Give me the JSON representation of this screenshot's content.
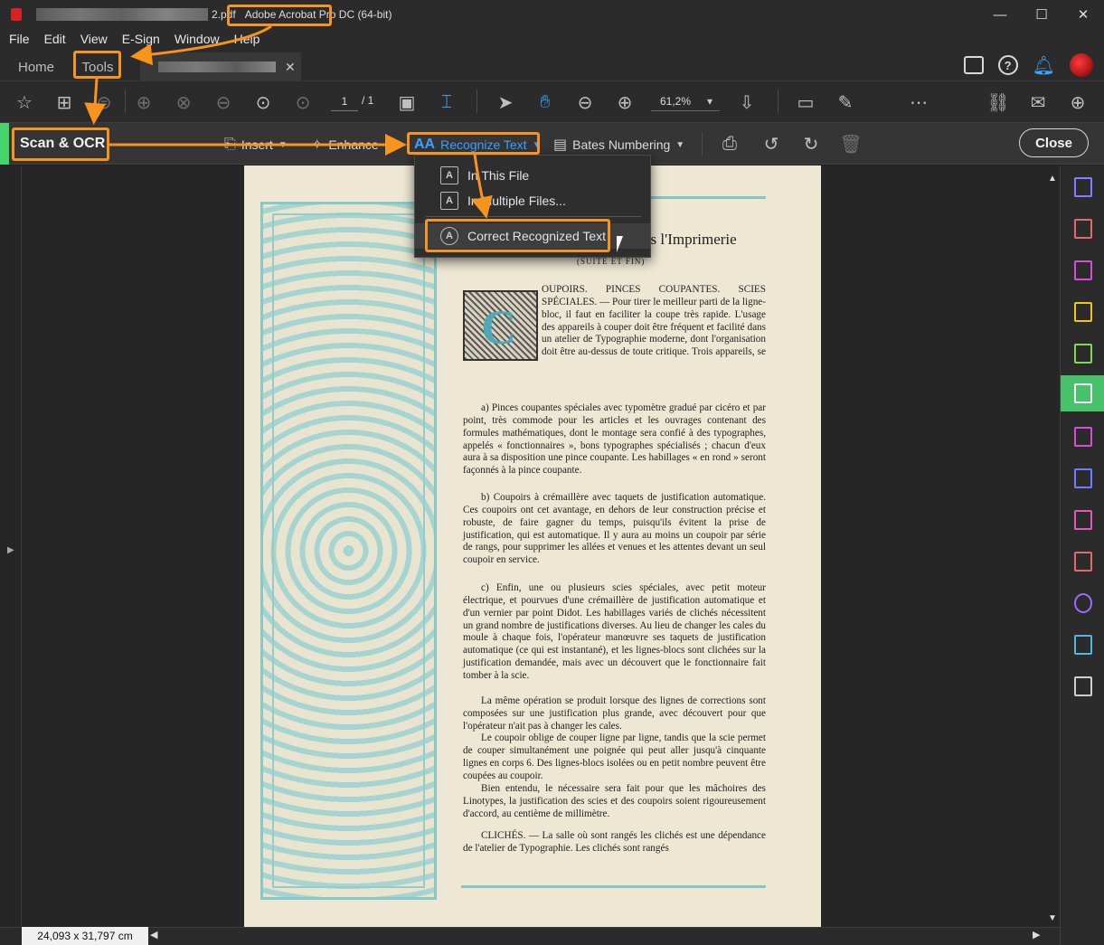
{
  "window": {
    "filename_suffix": "2.pdf",
    "app_title": "Adobe Acrobat Pro DC (64-bit)",
    "minimize": "—",
    "maximize": "☐",
    "close": "✕"
  },
  "menubar": [
    "File",
    "Edit",
    "View",
    "E-Sign",
    "Window",
    "Help"
  ],
  "tabs": {
    "home": "Home",
    "tools": "Tools",
    "doc_close": "✕"
  },
  "toolbar": {
    "page_current": "1",
    "page_total": "/ 1",
    "zoom": "61,2%"
  },
  "tool": {
    "title": "Scan & OCR",
    "insert": "Insert",
    "enhance": "Enhance",
    "recognize": "Recognize Text",
    "bates": "Bates Numbering",
    "close": "Close"
  },
  "recognize_menu": {
    "in_this_file": "In This File",
    "in_multiple_files": "In Multiple Files...",
    "correct_text": "Correct Recognized Text"
  },
  "document": {
    "heading": "dans   l'Imprimerie",
    "subheading": "(SUITE ET FIN)",
    "dropcap": "C",
    "intro": "OUPOIRS. PINCES COUPANTES. SCIES SPÉCIALES. — Pour tirer le meilleur parti de la ligne-bloc, il faut en faciliter la coupe très rapide. L'usage des appareils à couper doit être fréquent et facilité dans un atelier de Typographie moderne, dont l'organisation doit être au-dessus de toute critique. Trois appareils, se complétant très heureusement, et d'une utilité incontestable, peuvent être adoptés :",
    "para_a": "a) Pinces coupantes spéciales avec typomètre gradué par cicéro et par point, très commode pour les articles et les ouvrages contenant des formules mathématiques, dont le montage sera confié à des typographes, appelés « fonctionnaires », bons typographes spécialisés ; chacun d'eux aura à sa disposition une pince coupante. Les habillages « en rond » seront façonnés à la pince coupante.",
    "para_b": "b) Coupoirs à crémaillère avec taquets de justification automatique. Ces coupoirs ont cet avantage, en dehors de leur construction précise et robuste, de faire gagner du temps, puisqu'ils évitent la prise de justification, qui est automatique. Il y aura au moins un coupoir par série de rangs, pour supprimer les allées et venues et les attentes devant un seul coupoir en service.",
    "para_c": "c) Enfin, une ou plusieurs scies spéciales, avec petit moteur électrique, et pourvues d'une crémaillère de justification automatique et d'un vernier par point Didot. Les habillages variés de clichés nécessitent un grand nombre de justifications diverses. Au lieu de changer les cales du moule à chaque fois, l'opérateur manœuvre ses taquets de justification automatique (ce qui est instantané), et les lignes-blocs sont clichées sur la justification demandée, mais avec un découvert que le fonctionnaire fait tomber à la scie.",
    "para_d": "La même opération se produit lorsque des lignes de corrections sont composées sur une justification plus grande, avec découvert pour que l'opérateur n'ait pas à changer les cales.",
    "para_e": "Le coupoir oblige de couper ligne par ligne, tandis que la scie permet de couper simultanément une poignée qui peut aller jusqu'à cinquante lignes en corps 6. Des lignes-blocs isolées ou en petit nombre peuvent être coupées au coupoir.",
    "para_f": "Bien entendu, le nécessaire sera fait pour que les mâchoires des Linotypes, la justification des scies et des coupoirs soient rigoureusement d'accord, au centième de millimètre.",
    "para_g": "CLICHÉS. — La salle où sont rangés les clichés est une dépendance de l'atelier de Typographie. Les clichés sont rangés"
  },
  "status": {
    "dimensions": "24,093 x 31,797 cm"
  },
  "colors": {
    "accent_blue": "#3aa2ff",
    "highlight_orange": "#f7941d",
    "rail_selected": "#47c16a"
  },
  "icons": [
    "star-icon",
    "binoculars-icon",
    "prev-page-icon",
    "next-page-icon",
    "select-icon",
    "hand-icon",
    "zoom-out-icon",
    "zoom-in-icon",
    "comment-icon",
    "pen-icon",
    "more-icon",
    "link-icon",
    "mail-icon",
    "add-user-icon",
    "rotate-left-icon",
    "rotate-right-icon",
    "trash-icon"
  ]
}
